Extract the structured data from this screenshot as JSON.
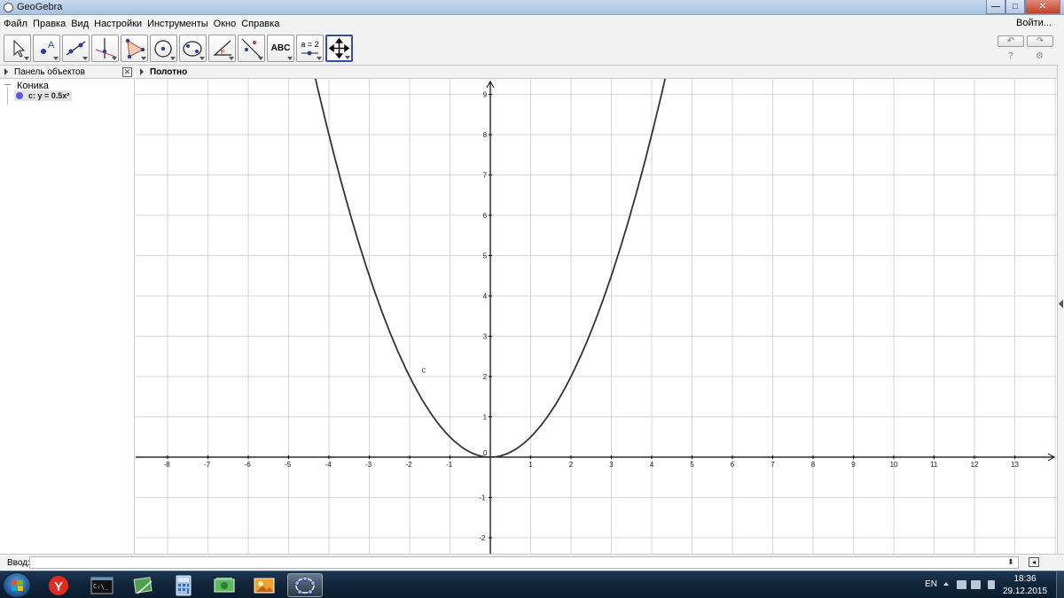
{
  "window": {
    "title": "GeoGebra",
    "minimize": "—",
    "maximize": "□",
    "close": "✕"
  },
  "menu": {
    "items": [
      "Файл",
      "Правка",
      "Вид",
      "Настройки",
      "Инструменты",
      "Окно",
      "Справка"
    ],
    "login": "Войти..."
  },
  "toolbar": {
    "tools": [
      "move-tool-icon",
      "point-tool-icon",
      "line-tool-icon",
      "perpendicular-line-tool-icon",
      "polygon-tool-icon",
      "circle-tool-icon",
      "conic-tool-icon",
      "angle-tool-icon",
      "reflect-tool-icon",
      "text-tool-icon",
      "slider-tool-icon",
      "move-graphics-view-tool-icon"
    ],
    "text_label": "ABC",
    "slider_label": "a = 2",
    "selected_index": 11,
    "undo": "↶",
    "redo": "↷",
    "help": "?",
    "settings": "⚙"
  },
  "algebra_panel": {
    "title": "Панель объектов",
    "category": "Коника",
    "objects": [
      {
        "label": "c: y = 0.5x²",
        "color": "#5a5ae8"
      }
    ],
    "close": "✕"
  },
  "graphics_panel": {
    "title": "Полотно",
    "curve_label": "c",
    "x_ticks": [
      "-8",
      "-7",
      "-6",
      "-5",
      "-4",
      "-3",
      "-2",
      "-1",
      "0",
      "1",
      "2",
      "3",
      "4",
      "5",
      "6",
      "7",
      "8",
      "9",
      "10",
      "11",
      "12",
      "13"
    ],
    "y_ticks": [
      "-2",
      "-1",
      "1",
      "2",
      "3",
      "4",
      "5",
      "6",
      "7",
      "8",
      "9"
    ]
  },
  "input_bar": {
    "label": "Ввод:",
    "value": "",
    "placeholder": ""
  },
  "taskbar": {
    "apps": [
      "yandex-browser-icon",
      "command-prompt-icon",
      "tablet-pc-icon",
      "calculator-icon",
      "money-app-icon",
      "photo-viewer-icon",
      "geogebra-taskbar-icon"
    ],
    "language": "EN",
    "time": "18:36",
    "date": "29.12.2015"
  },
  "colors": {
    "curve": "#333333",
    "grid": "#d6d6d6",
    "axes": "#000000",
    "selected_tool_border": "#2f4fa8"
  },
  "chart_data": {
    "type": "line",
    "title": "",
    "series": [
      {
        "name": "c",
        "expression": "y = 0.5x²",
        "x": [
          -4.34,
          -4,
          -3.5,
          -3,
          -2.5,
          -2,
          -1.5,
          -1,
          -0.5,
          0,
          0.5,
          1,
          1.5,
          2,
          2.5,
          3,
          3.5,
          4,
          4.34
        ],
        "y": [
          9.42,
          8,
          6.125,
          4.5,
          3.125,
          2,
          1.125,
          0.5,
          0.125,
          0,
          0.125,
          0.5,
          1.125,
          2,
          3.125,
          4.5,
          6.125,
          8,
          9.42
        ]
      }
    ],
    "xlim": [
      -8.8,
      14.0
    ],
    "ylim": [
      -2.4,
      9.4
    ],
    "grid": true,
    "xlabel": "",
    "ylabel": ""
  }
}
